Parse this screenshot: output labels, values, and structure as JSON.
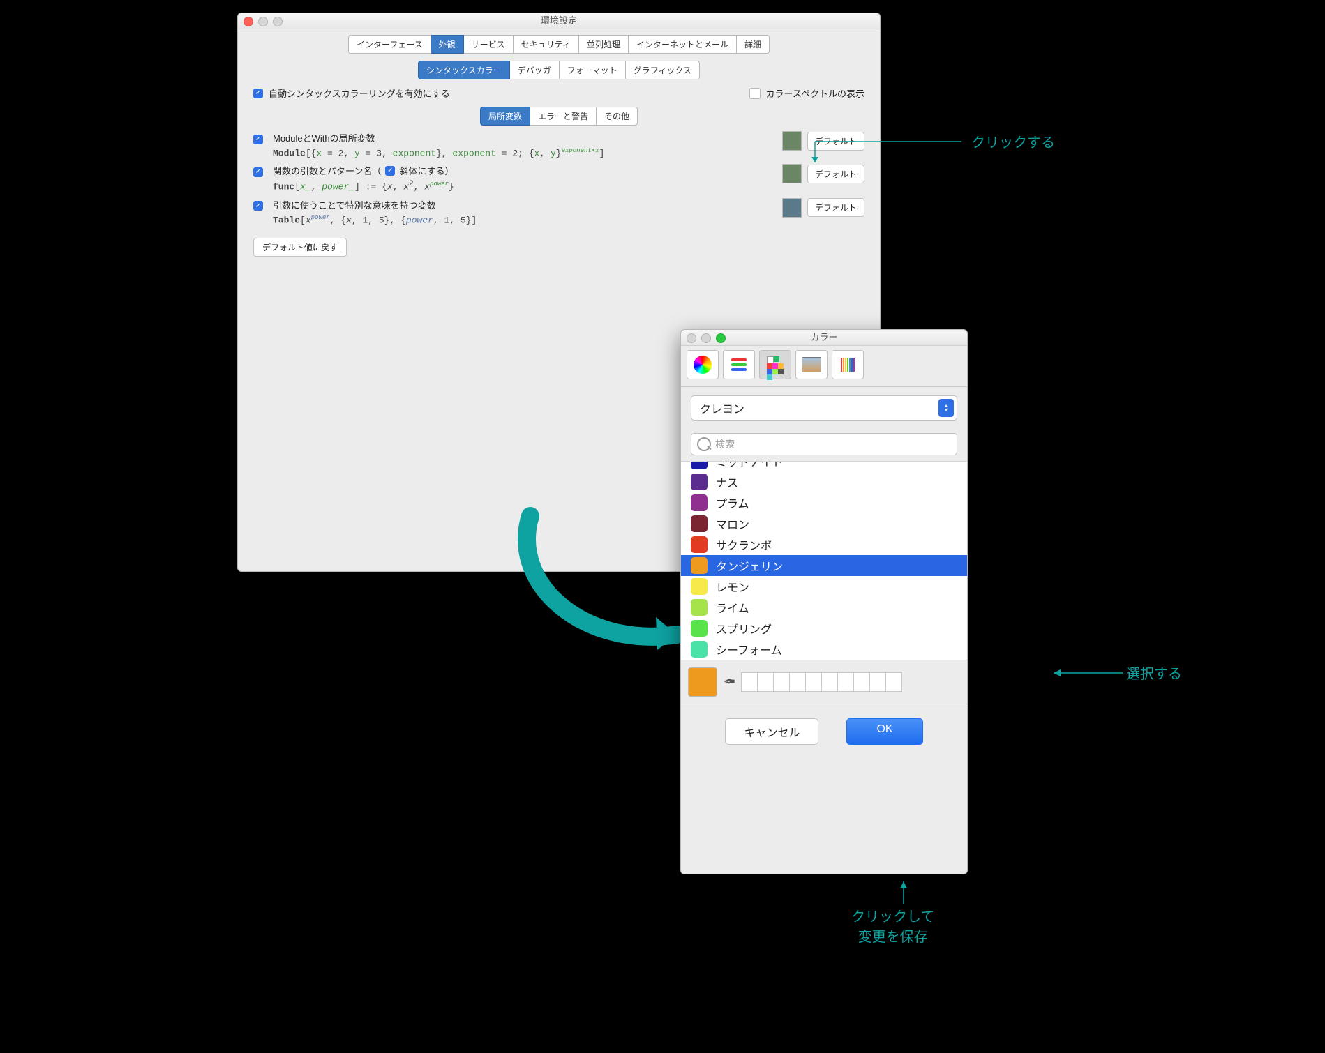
{
  "pref": {
    "title": "環境設定",
    "tabs1": [
      "インターフェース",
      "外観",
      "サービス",
      "セキュリティ",
      "並列処理",
      "インターネットとメール",
      "詳細"
    ],
    "tabs1_sel": 1,
    "tabs2": [
      "シンタックスカラー",
      "デバッガ",
      "フォーマット",
      "グラフィックス"
    ],
    "tabs2_sel": 0,
    "auto_label": "自動シンタックスカラーリングを有効にする",
    "spectrum_label": "カラースペクトルの表示",
    "tabs3": [
      "局所変数",
      "エラーと警告",
      "その他"
    ],
    "tabs3_sel": 0,
    "items": [
      {
        "title": "ModuleとWithの局所変数",
        "default": "デフォルト",
        "swatch": "#6b8664"
      },
      {
        "title": "関数の引数とパターン名（",
        "italic_label": "斜体にする）",
        "default": "デフォルト",
        "swatch": "#6b8664"
      },
      {
        "title": "引数に使うことで特別な意味を持つ変数",
        "default": "デフォルト",
        "swatch": "#5a7a8a"
      }
    ],
    "restore": "デフォルト値に戻す"
  },
  "colorpanel": {
    "title": "カラー",
    "dropdown": "クレヨン",
    "search_placeholder": "検索",
    "colors": [
      {
        "name": "ミッドナイト",
        "c": "#1a1aa8",
        "cut": true
      },
      {
        "name": "ナス",
        "c": "#5a2d8f"
      },
      {
        "name": "プラム",
        "c": "#8f3090"
      },
      {
        "name": "マロン",
        "c": "#7a2531"
      },
      {
        "name": "サクランボ",
        "c": "#e23b24"
      },
      {
        "name": "タンジェリン",
        "c": "#ee9a1f",
        "sel": true
      },
      {
        "name": "レモン",
        "c": "#f8e94a"
      },
      {
        "name": "ライム",
        "c": "#a6e24a"
      },
      {
        "name": "スプリング",
        "c": "#5ae24a"
      },
      {
        "name": "シーフォーム",
        "c": "#4ae2a6"
      }
    ],
    "cancel": "キャンセル",
    "ok": "OK"
  },
  "callouts": {
    "click": "クリックする",
    "select": "選択する",
    "save1": "クリックして",
    "save2": "変更を保存"
  }
}
